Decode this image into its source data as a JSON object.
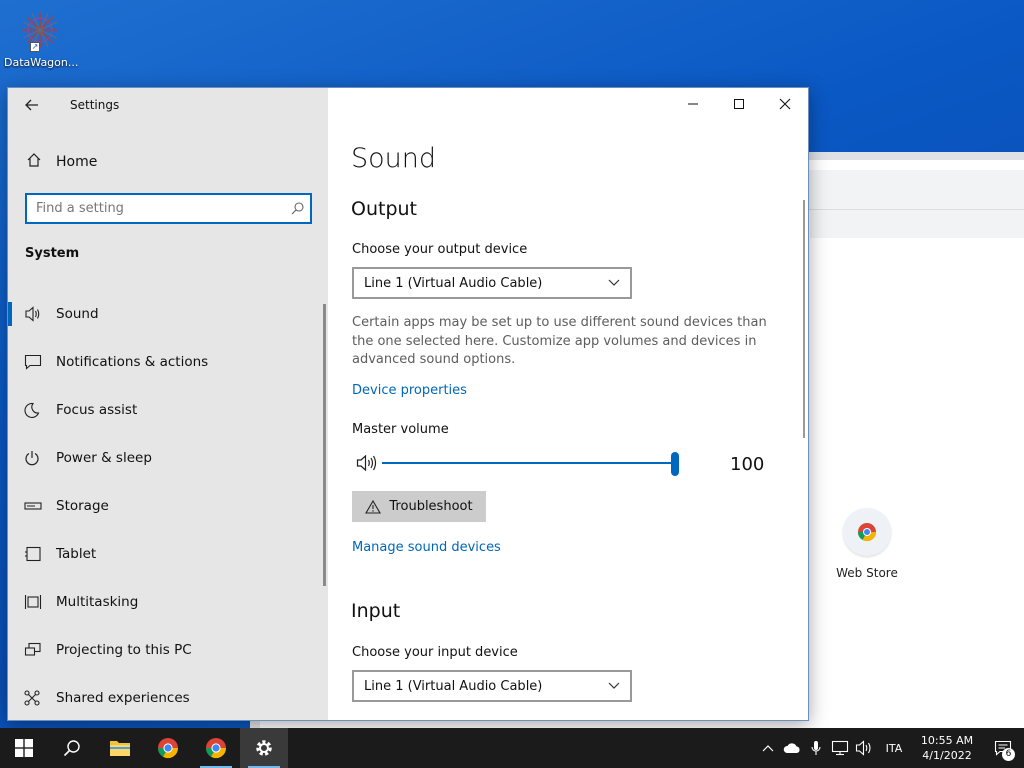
{
  "desktop": {
    "icon_label": "DataWagon...",
    "webstore_label": "Web Store"
  },
  "window": {
    "title": "Settings",
    "controls": {
      "minimize": "—",
      "maximize": "☐",
      "close": "✕"
    }
  },
  "nav": {
    "home": "Home",
    "search_placeholder": "Find a setting",
    "section": "System",
    "items": [
      {
        "label": "Sound",
        "icon": "speaker-icon",
        "active": true
      },
      {
        "label": "Notifications & actions",
        "icon": "message-icon"
      },
      {
        "label": "Focus assist",
        "icon": "moon-icon"
      },
      {
        "label": "Power & sleep",
        "icon": "power-icon"
      },
      {
        "label": "Storage",
        "icon": "storage-icon"
      },
      {
        "label": "Tablet",
        "icon": "tablet-icon"
      },
      {
        "label": "Multitasking",
        "icon": "multitasking-icon"
      },
      {
        "label": "Projecting to this PC",
        "icon": "projecting-icon"
      },
      {
        "label": "Shared experiences",
        "icon": "shared-icon"
      }
    ]
  },
  "content": {
    "title": "Sound",
    "output": {
      "heading": "Output",
      "device_label": "Choose your output device",
      "device_value": "Line 1 (Virtual Audio Cable)",
      "description": "Certain apps may be set up to use different sound devices than the one selected here. Customize app volumes and devices in advanced sound options.",
      "device_properties_link": "Device properties",
      "master_volume_label": "Master volume",
      "volume_value": "100",
      "volume_level": 100,
      "troubleshoot_label": "Troubleshoot",
      "manage_link": "Manage sound devices"
    },
    "input": {
      "heading": "Input",
      "device_label": "Choose your input device",
      "device_value": "Line 1 (Virtual Audio Cable)"
    }
  },
  "taskbar": {
    "language": "ITA",
    "time": "10:55 AM",
    "date": "4/1/2022",
    "notification_count": "6"
  },
  "colors": {
    "accent": "#0067c0",
    "link": "#0067b8",
    "taskbar": "#1b1b1b"
  }
}
